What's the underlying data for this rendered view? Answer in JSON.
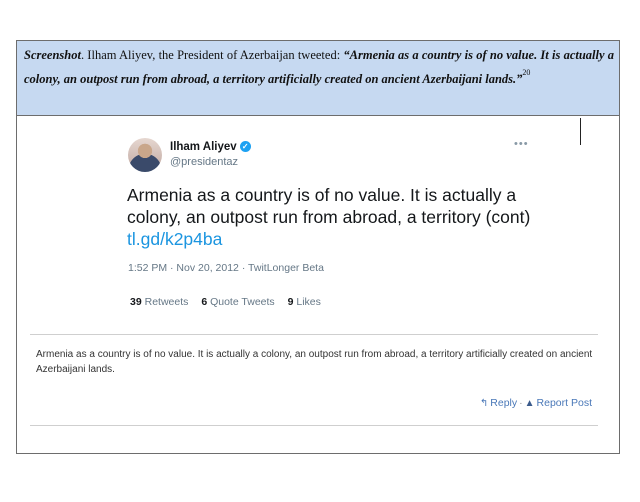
{
  "caption": {
    "label": "Screenshot",
    "intro": ". Ilham Aliyev, the President of Azerbaijan tweeted: ",
    "quote": "“Armenia as a country is of no value. It is actually a colony, an outpost run from abroad, a territory artificially created on ancient Azerbaijani lands.”",
    "footnote": "20"
  },
  "tweet": {
    "name": "Ilham Aliyev",
    "handle": "@presidentaz",
    "more": "•••",
    "text": "Armenia as a country is of no value. It is actually a colony, an outpost run from abroad, a territory (cont)",
    "link": "tl.gd/k2p4ba",
    "meta": "1:52 PM · Nov 20, 2012 · TwitLonger Beta",
    "retweets_count": "39",
    "retweets_label": "Retweets",
    "quotes_count": "6",
    "quotes_label": "Quote Tweets",
    "likes_count": "9",
    "likes_label": "Likes"
  },
  "post": {
    "text": "Armenia as a country is of no value. It is actually a colony, an outpost run from abroad, a territory artificially created on ancient Azerbaijani lands.",
    "reply_label": "Reply",
    "separator": "·",
    "report_label": "Report Post"
  },
  "icons": {
    "verified": "verified-badge-icon",
    "reply": "reply-arrow-icon",
    "report": "warning-triangle-icon",
    "more": "more-dots-icon"
  },
  "colors": {
    "caption_bg": "#c6d9f1",
    "link": "#1b95e0",
    "verified": "#1da1f2",
    "action_link": "#4a78b8"
  }
}
